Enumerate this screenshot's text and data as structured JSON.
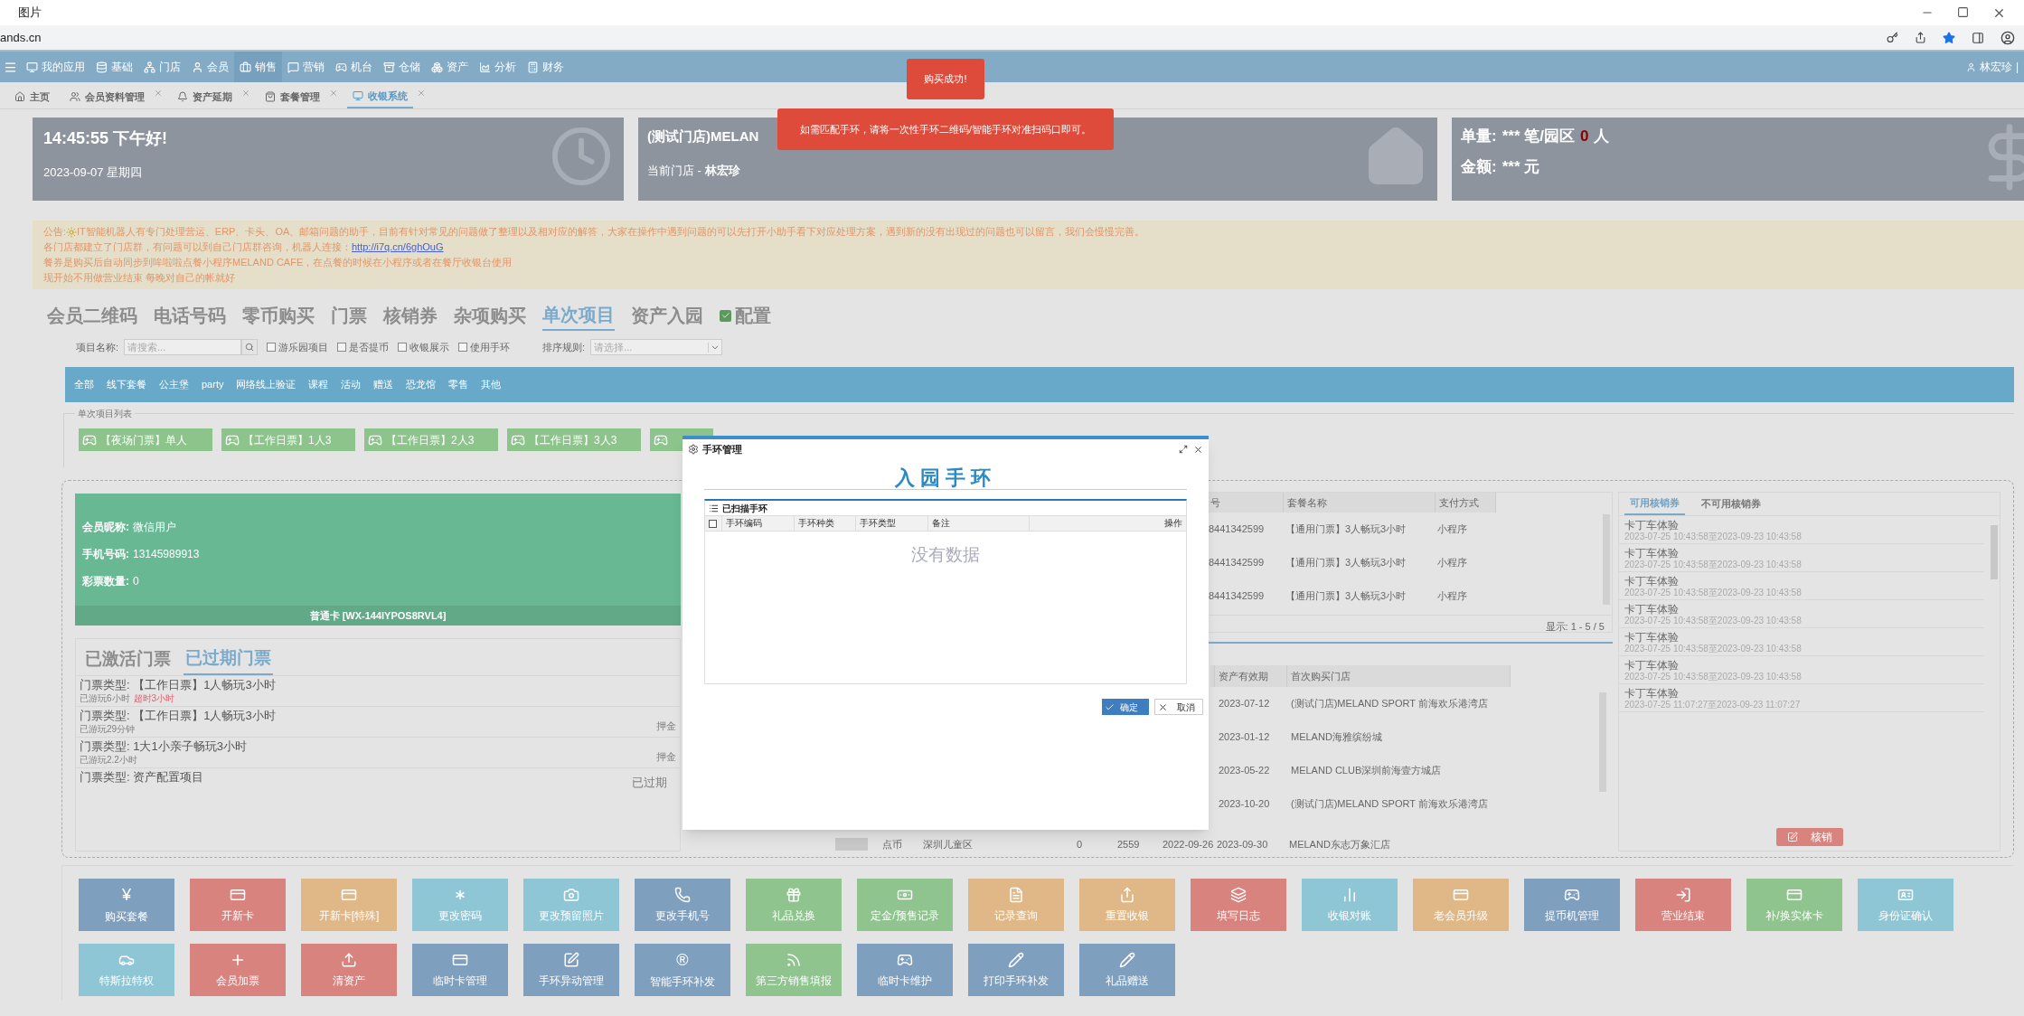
{
  "browser": {
    "tab_title": "图片",
    "address": "ands.cn"
  },
  "nav": {
    "items": [
      {
        "label": "我的应用",
        "selected": false
      },
      {
        "label": "基础",
        "selected": false
      },
      {
        "label": "门店",
        "selected": false
      },
      {
        "label": "会员",
        "selected": false
      },
      {
        "label": "销售",
        "selected": true
      },
      {
        "label": "营销",
        "selected": false
      },
      {
        "label": "机台",
        "selected": false
      },
      {
        "label": "仓储",
        "selected": false
      },
      {
        "label": "资产",
        "selected": false
      },
      {
        "label": "分析",
        "selected": false
      },
      {
        "label": "财务",
        "selected": false
      }
    ],
    "user": "林宏珍",
    "separator": "|"
  },
  "tabs": [
    {
      "label": "主页",
      "closable": false,
      "selected": false
    },
    {
      "label": "会员资料管理",
      "closable": true,
      "selected": false
    },
    {
      "label": "资产延期",
      "closable": true,
      "selected": false
    },
    {
      "label": "套餐管理",
      "closable": true,
      "selected": false
    },
    {
      "label": "收银系统",
      "closable": true,
      "selected": true
    }
  ],
  "cards": {
    "time": {
      "greeting": "14:45:55 下午好!",
      "date": "2023-09-07 星期四"
    },
    "store": {
      "name": "(测试门店)MELAN",
      "current": "当前门店 - **林宏珍**"
    },
    "stats": {
      "count_label": "单量:",
      "count_value": "*** 笔/园区",
      "park_count": "0",
      "park_unit": "人",
      "amount_label": "金额:",
      "amount_value": "*** 元"
    }
  },
  "toasts": [
    "购买成功!",
    "如需匹配手环，请将一次性手环二维码/智能手环对准扫码口即可。"
  ],
  "notice": {
    "prefix": "公告:",
    "line1": "IT智能机器人有专门处理营运、ERP、卡头、OA、邮箱问题的助手，目前有针对常见的问题做了整理以及相对应的解答，大家在操作中遇到问题的可以先打开小助手看下对应处理方案，遇到新的没有出现过的问题也可以留言，我们会慢慢完善。",
    "line2": "各门店都建立了门店群，有问题可以到自己门店群咨询，机器人连接：",
    "link": "http://i7q.cn/6ghOuG",
    "line3": "餐券是购买后自动同步到哞啦啦点餐小程序MELAND CAFE，在点餐的时候在小程序或者在餐厅收银台使用",
    "line4": "现开始不用做营业结束 每晚对自己的帐就好"
  },
  "main_tabs": [
    {
      "label": "会员二维码",
      "selected": false
    },
    {
      "label": "电话号码",
      "selected": false
    },
    {
      "label": "零币购买",
      "selected": false
    },
    {
      "label": "门票",
      "selected": false
    },
    {
      "label": "核销券",
      "selected": false
    },
    {
      "label": "杂项购买",
      "selected": false
    },
    {
      "label": "单次项目",
      "selected": true
    },
    {
      "label": "资产入园",
      "selected": false
    }
  ],
  "config": {
    "label": "配置",
    "checked": true
  },
  "filter": {
    "name_label": "项目名称:",
    "search_placeholder": "请搜索...",
    "checks": [
      {
        "label": "游乐园项目",
        "checked": false
      },
      {
        "label": "是否提币",
        "checked": false
      },
      {
        "label": "收银展示",
        "checked": false
      },
      {
        "label": "使用手环",
        "checked": false
      }
    ],
    "sort_label": "排序规则:",
    "sort_placeholder": "请选择..."
  },
  "categories": [
    "全部",
    "线下套餐",
    "公主堡",
    "party",
    "网络线上验证",
    "课程",
    "活动",
    "赠送",
    "恐龙馆",
    "零售",
    "其他"
  ],
  "item_list": {
    "legend": "单次项目列表",
    "items": [
      "【夜场门票】单人",
      "【工作日票】1人3",
      "【工作日票】2人3",
      "【工作日票】3人3"
    ]
  },
  "member": {
    "fields": [
      {
        "label": "会员昵称:",
        "value": "微信用户"
      },
      {
        "label": "手机号码:",
        "value": "13145989913"
      },
      {
        "label": "彩票数量:",
        "value": "0"
      }
    ],
    "card": "普通卡 [WX-144IYPOS8RVL4]"
  },
  "tickets": {
    "tabs": [
      {
        "label": "已激活门票",
        "selected": false
      },
      {
        "label": "已过期门票",
        "selected": true
      }
    ],
    "rows": [
      {
        "type": "门票类型: 【工作日票】1人畅玩3小时",
        "played": "已游玩6小时",
        "overtime": "超时3小时"
      },
      {
        "type": "门票类型: 【工作日票】1人畅玩3小时",
        "played": "已游玩29分钟",
        "deposit": "押金"
      },
      {
        "type": "门票类型: 1大1小亲子畅玩3小时",
        "played": "已游玩2.2小时",
        "deposit": "押金"
      },
      {
        "type": "门票类型: 资产配置项目",
        "status": "已过期"
      }
    ]
  },
  "orders": {
    "columns": [
      "号",
      "套餐名称",
      "支付方式"
    ],
    "rows": [
      [
        "8441342599",
        "【通用门票】3人畅玩3小时",
        "小程序"
      ],
      [
        "8441342599",
        "【通用门票】3人畅玩3小时",
        "小程序"
      ],
      [
        "8441342599",
        "【通用门票】3人畅玩3小时",
        "小程序"
      ]
    ],
    "display": "显示: 1 - 5 / 5"
  },
  "assets": {
    "columns": [
      "资产有效期",
      "首次购买门店"
    ],
    "rows": [
      [
        "2023-07-12",
        "(测试门店)MELAND SPORT 前海欢乐港湾店"
      ],
      [
        "2023-01-12",
        "MELAND海雅缤纷城"
      ],
      [
        "2023-05-22",
        "MELAND CLUB深圳前海壹方城店"
      ],
      [
        "2023-10-20",
        "(测试门店)MELAND SPORT 前海欢乐港湾店"
      ]
    ],
    "last_row": [
      "点币",
      "深圳儿童区",
      "0",
      "2559",
      "2022-09-26",
      "2023-09-30",
      "MELAND东志万象汇店"
    ]
  },
  "coupons": {
    "tabs": [
      {
        "label": "可用核销券",
        "selected": true
      },
      {
        "label": "不可用核销券",
        "selected": false
      }
    ],
    "items": [
      {
        "name": "卡丁车体验",
        "period": "2023-07-25 10:43:58至2023-09-23 10:43:58"
      },
      {
        "name": "卡丁车体验",
        "period": "2023-07-25 10:43:58至2023-09-23 10:43:58"
      },
      {
        "name": "卡丁车体验",
        "period": "2023-07-25 10:43:58至2023-09-23 10:43:58"
      },
      {
        "name": "卡丁车体验",
        "period": "2023-07-25 10:43:58至2023-09-23 10:43:58"
      },
      {
        "name": "卡丁车体验",
        "period": "2023-07-25 10:43:58至2023-09-23 10:43:58"
      },
      {
        "name": "卡丁车体验",
        "period": "2023-07-25 10:43:58至2023-09-23 10:43:58"
      },
      {
        "name": "卡丁车体验",
        "period": "2023-07-25 11:07:27至2023-09-23 11:07:27"
      }
    ],
    "button": "核销"
  },
  "modal": {
    "title": "手环管理",
    "heading": "入园手环",
    "section": "已扫描手环",
    "columns": [
      "手环编码",
      "手环种类",
      "手环类型",
      "备注",
      "操作"
    ],
    "empty": "没有数据",
    "select_all_checked": false,
    "ok": "确定",
    "cancel": "取消"
  },
  "actions": [
    {
      "label": "购买套餐",
      "color": "#7f9fbf",
      "glyph": "¥"
    },
    {
      "label": "开新卡",
      "color": "#d9837f"
    },
    {
      "label": "开新卡[特殊]",
      "color": "#e0b887"
    },
    {
      "label": "更改密码",
      "color": "#8fc6d6"
    },
    {
      "label": "更改预留照片",
      "color": "#8fc6d6"
    },
    {
      "label": "更改手机号",
      "color": "#7f9fbf"
    },
    {
      "label": "礼品兑换",
      "color": "#8fc48f"
    },
    {
      "label": "定金/预售记录",
      "color": "#8fc48f"
    },
    {
      "label": "记录查询",
      "color": "#e0b887"
    },
    {
      "label": "重置收银",
      "color": "#e0b887"
    },
    {
      "label": "填写日志",
      "color": "#d9837f"
    },
    {
      "label": "收银对账",
      "color": "#8fc6d6"
    },
    {
      "label": "老会员升级",
      "color": "#e0b887"
    },
    {
      "label": "提币机管理",
      "color": "#7f9fbf"
    },
    {
      "label": "营业结束",
      "color": "#d9837f"
    },
    {
      "label": "补/换实体卡",
      "color": "#8fc48f"
    },
    {
      "label": "身份证确认",
      "color": "#8fc6d6"
    },
    {
      "label": "特斯拉特权",
      "color": "#8fc6d6"
    },
    {
      "label": "会员加票",
      "color": "#d9837f"
    },
    {
      "label": "清资产",
      "color": "#d9837f"
    },
    {
      "label": "临时卡管理",
      "color": "#7f9fbf"
    },
    {
      "label": "手环异动管理",
      "color": "#7f9fbf"
    },
    {
      "label": "智能手环补发",
      "color": "#7f9fbf",
      "glyph": "®"
    },
    {
      "label": "第三方销售填报",
      "color": "#8fc48f"
    },
    {
      "label": "临时卡维护",
      "color": "#7f9fbf"
    },
    {
      "label": "打印手环补发",
      "color": "#7f9fbf"
    },
    {
      "label": "礼品赠送",
      "color": "#7f9fbf"
    }
  ]
}
